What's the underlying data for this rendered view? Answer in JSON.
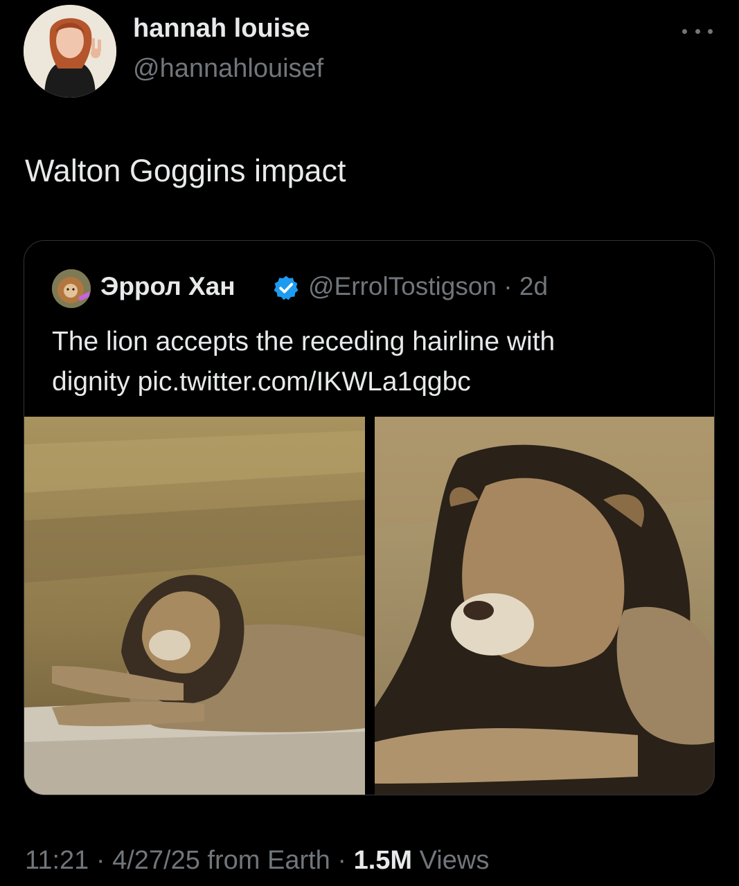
{
  "tweet": {
    "display_name": "hannah louise",
    "handle": "@hannahlouisef",
    "text": "Walton Goggins impact",
    "time": "11:21",
    "date": "4/27/25",
    "source": "from Earth",
    "views_count": "1.5M",
    "views_label": "Views",
    "separator": " · "
  },
  "quoted_tweet": {
    "display_name": "Эррол Хан",
    "handle": "@ErrolTostigson",
    "age": "2d",
    "separator": " · ",
    "text_line1": "The lion accepts the receding hairline with",
    "text_line2": "dignity pic.twitter.com/IKWLa1qgbc"
  },
  "colors": {
    "background": "#000000",
    "primary_text": "#e7e9ea",
    "secondary_text": "#71767b",
    "border": "#2f3336",
    "verified_badge": "#1d9bf0"
  },
  "icons": {
    "more": "more-icon",
    "verified": "verified-badge-icon"
  }
}
